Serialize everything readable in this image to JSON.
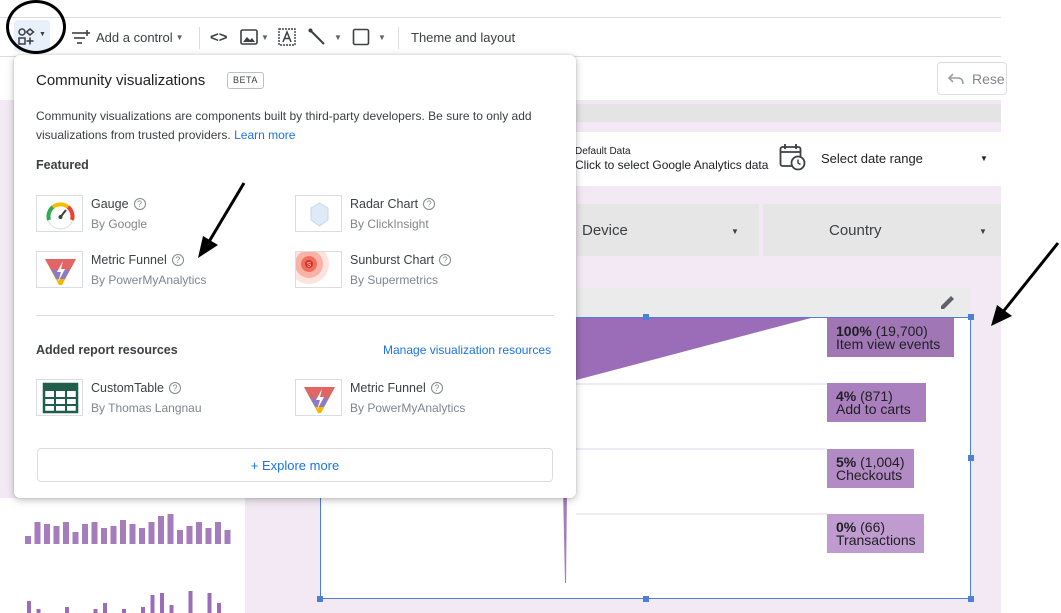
{
  "toolbar": {
    "add_control_label": "Add a control",
    "theme_layout_label": "Theme and layout",
    "icons": [
      "community-viz-icon",
      "add-control-icon",
      "code-icon",
      "image-icon",
      "text-icon",
      "line-icon",
      "shape-icon"
    ]
  },
  "reset_button": {
    "label": "Rese"
  },
  "data_control": {
    "line1": "Default Data",
    "line2": "Click to select Google Analytics data"
  },
  "date_range": {
    "label": "Select date range"
  },
  "filters": [
    {
      "label": "Device"
    },
    {
      "label": "Country"
    }
  ],
  "popup": {
    "title": "Community visualizations",
    "beta": "BETA",
    "description": "Community visualizations are components built by third-party developers. Be sure to only add visualizations from trusted providers.",
    "learn_more": "Learn more",
    "featured_heading": "Featured",
    "featured": [
      {
        "name": "Gauge",
        "by": "By Google"
      },
      {
        "name": "Radar Chart",
        "by": "By ClickInsight"
      },
      {
        "name": "Metric Funnel",
        "by": "By PowerMyAnalytics"
      },
      {
        "name": "Sunburst Chart",
        "by": "By Supermetrics"
      }
    ],
    "added_heading": "Added report resources",
    "manage_link": "Manage visualization resources",
    "added": [
      {
        "name": "CustomTable",
        "by": "By Thomas Langnau"
      },
      {
        "name": "Metric Funnel",
        "by": "By PowerMyAnalytics"
      }
    ],
    "explore_more": "+ Explore more"
  },
  "funnel": {
    "stages": [
      {
        "pct": "100%",
        "count": "(19,700)",
        "label": "Item view events",
        "value": 19700
      },
      {
        "pct": "4%",
        "count": "(871)",
        "label": "Add to carts",
        "value": 871
      },
      {
        "pct": "5%",
        "count": "(1,004)",
        "label": "Checkouts",
        "value": 1004
      },
      {
        "pct": "0%",
        "count": "(66)",
        "label": "Transactions",
        "value": 66
      }
    ],
    "colors": {
      "primary": "#9b6cb7",
      "stage_bg": [
        "#a076b5",
        "#a97fbd",
        "#b28ac4",
        "#bf9bcf"
      ]
    }
  },
  "colors": {
    "accent": "#1a73e8",
    "selection": "#4c7fd6",
    "canvas": "#f3e9f4"
  }
}
